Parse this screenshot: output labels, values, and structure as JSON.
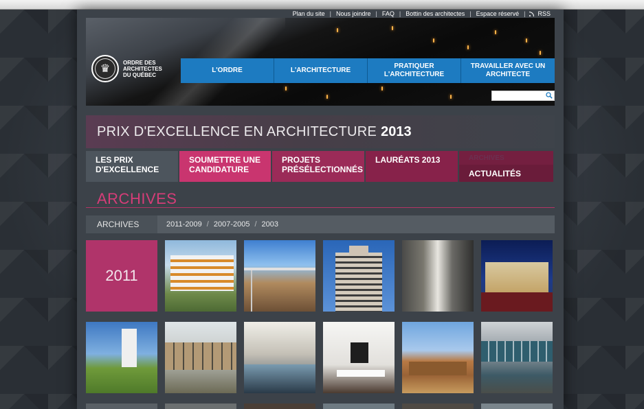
{
  "utility_nav": {
    "links": [
      "Plan du site",
      "Nous joindre",
      "FAQ",
      "Bottin des architectes",
      "Espace réservé",
      "RSS"
    ]
  },
  "logo": {
    "text": "ORDRE DES ARCHITECTES DU QUÉBEC"
  },
  "main_nav": {
    "items": [
      "L'ORDRE",
      "L'ARCHITECTURE",
      "PRATIQUER L'ARCHITECTURE",
      "TRAVAILLER AVEC UN ARCHITECTE"
    ]
  },
  "search": {
    "placeholder": ""
  },
  "title": {
    "light": "PRIX D'EXCELLENCE EN ARCHITECTURE",
    "bold": "2013"
  },
  "section_tabs": {
    "items": [
      "LES PRIX D'EXCELLENCE",
      "SOUMETTRE UNE CANDIDATURE",
      "PROJETS PRÉSÉLECTIONNÉS",
      "LAURÉATS 2013"
    ],
    "last_sub": "ARCHIVES",
    "last_main": "ACTUALITÉS"
  },
  "archives_heading": "ARCHIVES",
  "archive_bar": {
    "label": "ARCHIVES",
    "years": [
      "2011-2009",
      "2007-2005",
      "2003"
    ]
  },
  "grid": {
    "year_label": "2011"
  },
  "colors": {
    "accent_pink": "#c9356f",
    "accent_blue": "#1d7bc1",
    "year_tile": "#b0346a"
  }
}
